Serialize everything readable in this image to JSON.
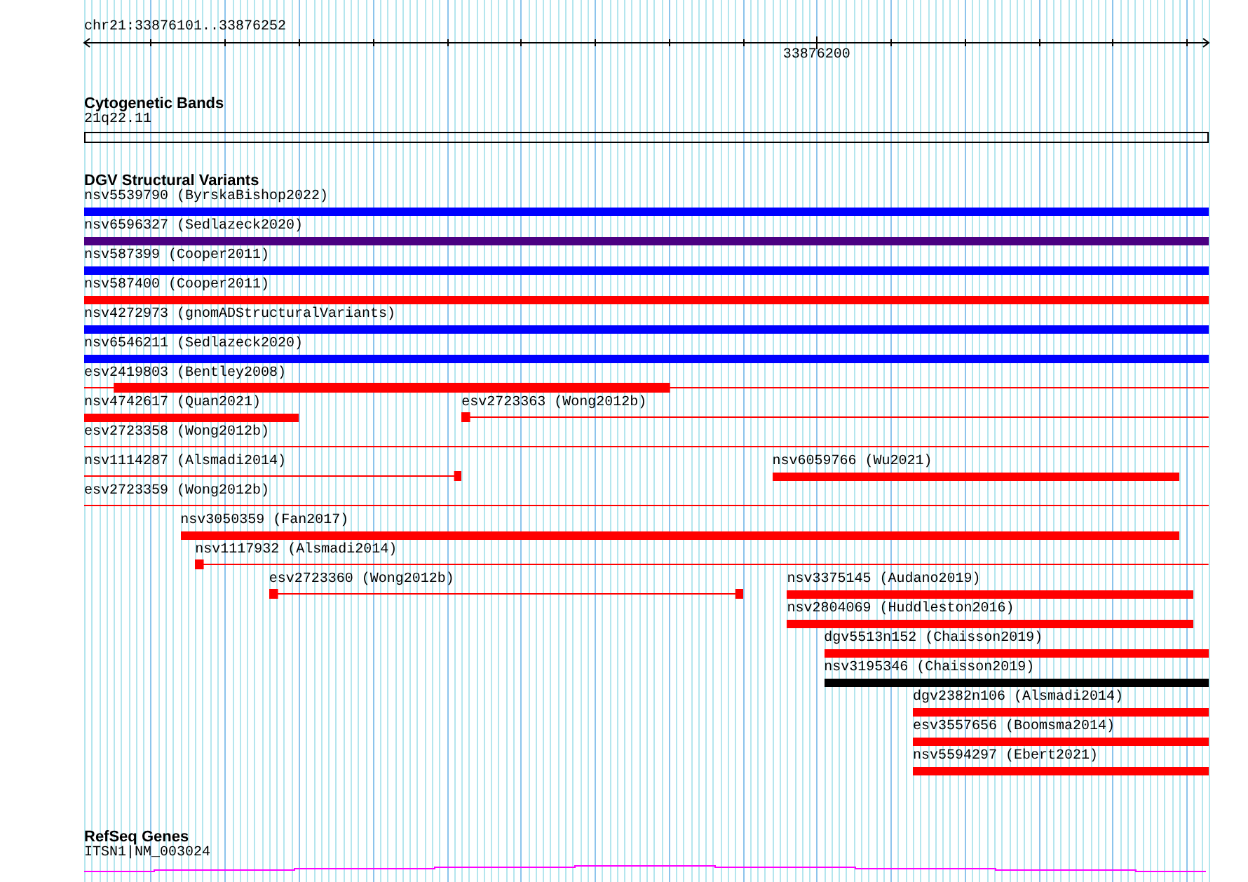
{
  "region": {
    "label": "chr21:33876101..33876252",
    "ticks": [
      {
        "label": "33876200"
      }
    ]
  },
  "cytoband_track": {
    "title": "Cytogenetic Bands",
    "band": "21q22.11"
  },
  "variant_track": {
    "title": "DGV Structural Variants",
    "rows": [
      {
        "features": [
          {
            "label": "nsv5539790 (ByrskaBishop2022)",
            "color": "#0000ff",
            "kind": "bar"
          }
        ]
      },
      {
        "features": [
          {
            "label": "nsv6596327 (Sedlazeck2020)",
            "color": "#4b0082",
            "kind": "bar"
          }
        ]
      },
      {
        "features": [
          {
            "label": "nsv587399 (Cooper2011)",
            "color": "#0000ff",
            "kind": "bar"
          }
        ]
      },
      {
        "features": [
          {
            "label": "nsv587400 (Cooper2011)",
            "color": "#ff0000",
            "kind": "bar"
          }
        ]
      },
      {
        "features": [
          {
            "label": "nsv4272973 (gnomADStructuralVariants)",
            "color": "#0000ff",
            "kind": "bar"
          }
        ]
      },
      {
        "features": [
          {
            "label": "nsv6546211 (Sedlazeck2020)",
            "color": "#0000ff",
            "kind": "bar"
          }
        ]
      },
      {
        "features": [
          {
            "label": "esv2419803 (Bentley2008)",
            "color": "#ff0000",
            "kind": "linked"
          }
        ]
      },
      {
        "features": [
          {
            "label": "nsv4742617 (Quan2021)",
            "color": "#ff0000",
            "kind": "bar"
          },
          {
            "label": "esv2723363 (Wong2012b)",
            "color": "#ff0000",
            "kind": "linked"
          }
        ]
      },
      {
        "features": [
          {
            "label": "esv2723358 (Wong2012b)",
            "color": "#ff0000",
            "kind": "linked"
          }
        ]
      },
      {
        "features": [
          {
            "label": "nsv1114287 (Alsmadi2014)",
            "color": "#ff0000",
            "kind": "linked"
          },
          {
            "label": "nsv6059766 (Wu2021)",
            "color": "#ff0000",
            "kind": "bar"
          }
        ]
      },
      {
        "features": [
          {
            "label": "esv2723359 (Wong2012b)",
            "color": "#ff0000",
            "kind": "linked"
          }
        ]
      },
      {
        "features": [
          {
            "label": "nsv3050359 (Fan2017)",
            "color": "#ff0000",
            "kind": "bar"
          }
        ]
      },
      {
        "features": [
          {
            "label": "nsv1117932 (Alsmadi2014)",
            "color": "#ff0000",
            "kind": "linked"
          }
        ]
      },
      {
        "features": [
          {
            "label": "esv2723360 (Wong2012b)",
            "color": "#ff0000",
            "kind": "linked"
          },
          {
            "label": "nsv3375145 (Audano2019)",
            "color": "#ff0000",
            "kind": "bar"
          }
        ]
      },
      {
        "features": [
          {
            "label": "nsv2804069 (Huddleston2016)",
            "color": "#ff0000",
            "kind": "bar"
          }
        ]
      },
      {
        "features": [
          {
            "label": "dgv5513n152 (Chaisson2019)",
            "color": "#ff0000",
            "kind": "bar"
          }
        ]
      },
      {
        "features": [
          {
            "label": "nsv3195346 (Chaisson2019)",
            "color": "#000000",
            "kind": "bar"
          }
        ]
      },
      {
        "features": [
          {
            "label": "dgv2382n106 (Alsmadi2014)",
            "color": "#ff0000",
            "kind": "bar"
          }
        ]
      },
      {
        "features": [
          {
            "label": "esv3557656 (Boomsma2014)",
            "color": "#ff0000",
            "kind": "bar"
          }
        ]
      },
      {
        "features": [
          {
            "label": "nsv5594297 (Ebert2021)",
            "color": "#ff0000",
            "kind": "bar"
          }
        ]
      }
    ]
  },
  "gene_track": {
    "title": "RefSeq Genes",
    "gene": "ITSN1|NM_003024"
  }
}
